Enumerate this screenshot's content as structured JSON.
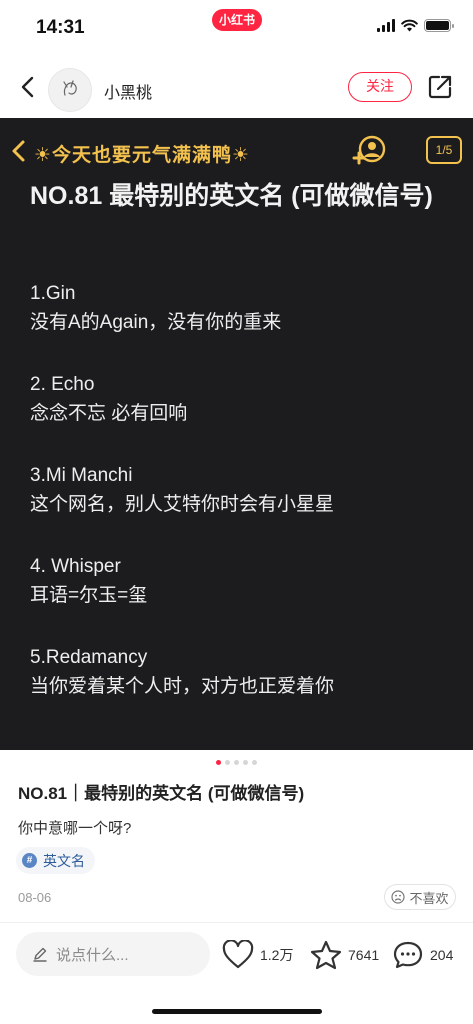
{
  "status_bar": {
    "time": "14:31",
    "app_badge": "小红书"
  },
  "nav": {
    "author_name": "小黑桃",
    "follow_label": "关注",
    "back_icon": "chevron-left-icon",
    "share_icon": "share-icon"
  },
  "image": {
    "header_title": "☀今天也要元气满满鸭☀",
    "pager": "1/5",
    "note_title": "NO.81 最特别的英文名 (可做微信号)",
    "items": [
      {
        "en": "1.Gin",
        "cn": "没有A的Again，没有你的重来"
      },
      {
        "en": "2. Echo",
        "cn": "念念不忘 必有回响"
      },
      {
        "en": "3.Mi Manchi",
        "cn": "这个网名，别人艾特你时会有小星星"
      },
      {
        "en": "4. Whisper",
        "cn": "耳语=尔玉=玺"
      },
      {
        "en": "5.Redamancy",
        "cn": "当你爱着某个人时，对方也正爱着你"
      }
    ]
  },
  "carousel": {
    "total": 5,
    "active": 1
  },
  "post": {
    "title": "NO.81｜最特别的英文名 (可做微信号)",
    "description": "你中意哪一个呀?",
    "tag_icon": "#",
    "tag": "英文名",
    "date": "08-06",
    "dislike_label": "不喜欢"
  },
  "bottom_bar": {
    "comment_placeholder": "说点什么...",
    "likes": "1.2万",
    "collects": "7641",
    "comments": "204"
  },
  "colors": {
    "brand": "#ff2442",
    "image_bg": "#1c1c1e",
    "image_accent": "#f2c14e",
    "tag_text": "#2f5d9c"
  }
}
